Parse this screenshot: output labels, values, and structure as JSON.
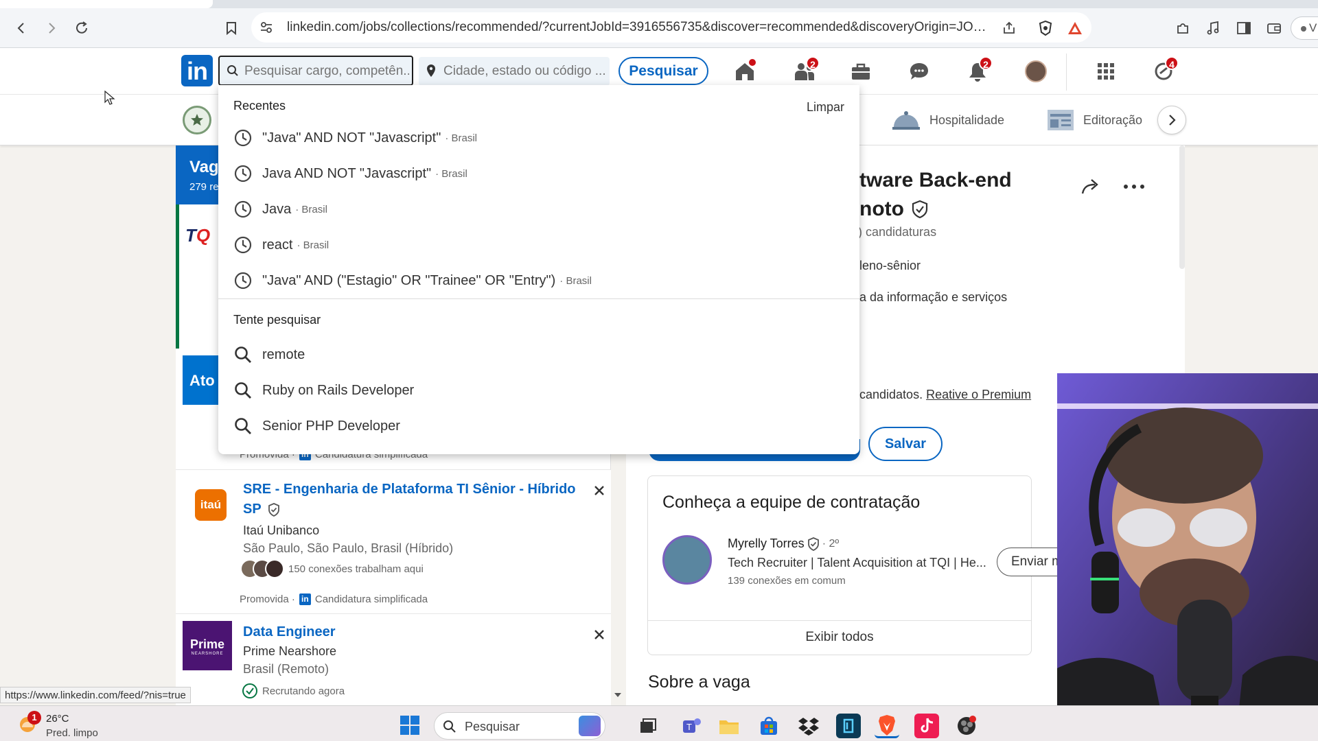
{
  "browser": {
    "url": "linkedin.com/jobs/collections/recommended/?currentJobId=3916556735&discover=recommended&discoveryOrigin=JOBS_H...",
    "profile_label": "V",
    "status_url": "https://www.linkedin.com/feed/?nis=true"
  },
  "header": {
    "logo": "in",
    "search_placeholder": "Pesquisar cargo, competên...",
    "location_placeholder": "Cidade, estado ou código ...",
    "search_button": "Pesquisar",
    "badges": {
      "network": "2",
      "notifications": "2",
      "premium": "4"
    }
  },
  "categories": [
    "Hospitalidade",
    "Editoração"
  ],
  "dropdown": {
    "recent_heading": "Recentes",
    "clear": "Limpar",
    "recent": [
      {
        "query": "\"Java\" AND NOT \"Javascript\"",
        "loc": "· Brasil"
      },
      {
        "query": "Java AND NOT \"Javascript\"",
        "loc": "· Brasil"
      },
      {
        "query": "Java",
        "loc": "· Brasil"
      },
      {
        "query": "react",
        "loc": "· Brasil"
      },
      {
        "query": "\"Java\" AND (\"Estagio\" OR \"Trainee\" OR \"Entry\")",
        "loc": "· Brasil"
      }
    ],
    "suggest_heading": "Tente pesquisar",
    "suggestions": [
      "remote",
      "Ruby on Rails Developer",
      "Senior PHP Developer"
    ]
  },
  "left": {
    "heading_short": "Vag",
    "results_short": "279 re",
    "promo_line": "Promovida · ",
    "easy_apply": "Candidatura simplificada",
    "jobs": [
      {
        "logo": "itaú",
        "logo_bg": "#ec7000",
        "title": "SRE - Engenharia de Plataforma TI Sênior - Híbrido SP",
        "company": "Itaú Unibanco",
        "location": "São Paulo, São Paulo, Brasil (Híbrido)",
        "connections": "150 conexões trabalham aqui",
        "footer_prefix": "Promovida · ",
        "footer": "Candidatura simplificada"
      },
      {
        "logo": "Prime",
        "logo_sub": "NEARSHORE",
        "logo_bg": "#4b1472",
        "title": "Data Engineer",
        "company": "Prime Nearshore",
        "location": "Brasil (Remoto)",
        "footer": "Recrutando agora"
      }
    ]
  },
  "detail": {
    "title_line1": "tware Back-end",
    "title_line2": "noto",
    "applicants": ") candidaturas",
    "level": "leno-sênior",
    "sector": "a da informação e serviços",
    "premium_text": "candidatos. ",
    "premium_link": "Reative o Premium",
    "save_button": "Salvar",
    "team_heading": "Conheça a equipe de contratação",
    "recruiter_name": "Myrelly Torres",
    "recruiter_degree": "· 2º",
    "recruiter_title": "Tech Recruiter | Talent Acquisition at TQI | He...",
    "recruiter_mutual": "139 conexões em comum",
    "message_button": "Enviar m",
    "show_all": "Exibir todos",
    "about_heading": "Sobre a vaga"
  },
  "taskbar": {
    "weather_temp": "26°C",
    "weather_desc": "Pred. limpo",
    "weather_badge": "1",
    "search_label": "Pesquisar"
  },
  "colors": {
    "linkedin_blue": "#0a66c2",
    "badge_red": "#cc1016"
  }
}
